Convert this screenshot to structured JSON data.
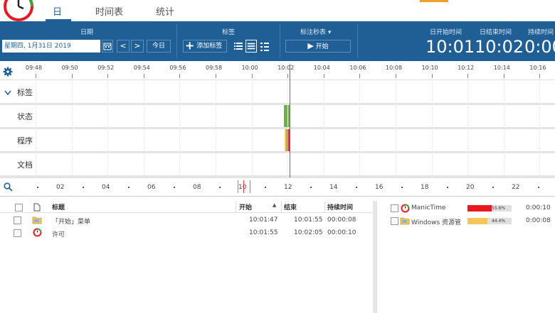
{
  "tabs": [
    {
      "label": "日"
    },
    {
      "label": "时间表"
    },
    {
      "label": "统计"
    }
  ],
  "toolbar": {
    "date_header": "日期",
    "date_value": "星期四, 1月31日 2019",
    "prev_label": "<",
    "next_label": ">",
    "today_label": "今日",
    "tag_header": "标签",
    "add_tag_label": "添加标签",
    "stopwatch_header": "标注秒表 ▾",
    "start_label": "开始",
    "day_start_header": "日开始时间",
    "day_start_value": "10:01",
    "day_end_header": "日结束时间",
    "day_end_value": "10:02",
    "duration_header": "持续时间",
    "duration_value": "0:00"
  },
  "ruler": {
    "labels": [
      "09:48",
      "09:50",
      "09:52",
      "09:54",
      "09:56",
      "09:58",
      "10:00",
      "10:02",
      "10:04",
      "10:06",
      "10:08",
      "10:10",
      "10:12",
      "10:14",
      "10:16"
    ]
  },
  "rows": {
    "tags": "标签",
    "status": "状态",
    "programs": "程序",
    "documents": "文档"
  },
  "day_strip": {
    "labels": [
      "02",
      "04",
      "06",
      "08",
      "10",
      "12",
      "14",
      "16",
      "18",
      "20",
      "22"
    ]
  },
  "table": {
    "col_title": "标题",
    "col_start": "开始",
    "col_end": "结束",
    "col_duration": "持续时间",
    "rows": [
      {
        "title": "「开始」菜单",
        "start": "10:01:47",
        "end": "10:01:55",
        "duration": "00:00:08",
        "icon": "folder-icon"
      },
      {
        "title": "许可",
        "start": "10:01:55",
        "end": "10:02:05",
        "duration": "00:00:10",
        "icon": "manictime-icon"
      }
    ]
  },
  "summary": {
    "rows": [
      {
        "name": "ManicTime",
        "percent": 55.6,
        "percent_label": "55.6%",
        "time": "0:00:10",
        "color": "#e8191f",
        "icon": "manictime-icon"
      },
      {
        "name": "Windows 资源管",
        "percent": 44.4,
        "percent_label": "44.4%",
        "time": "0:00:08",
        "color": "#f6c65b",
        "icon": "folder-icon"
      }
    ]
  },
  "colors": {
    "toolbar_bg": "#1f5f95",
    "cursor_red": "#e53935",
    "status_green": "#6db33f",
    "program_red": "#e8191f",
    "program_yellow": "#f6c65b"
  }
}
